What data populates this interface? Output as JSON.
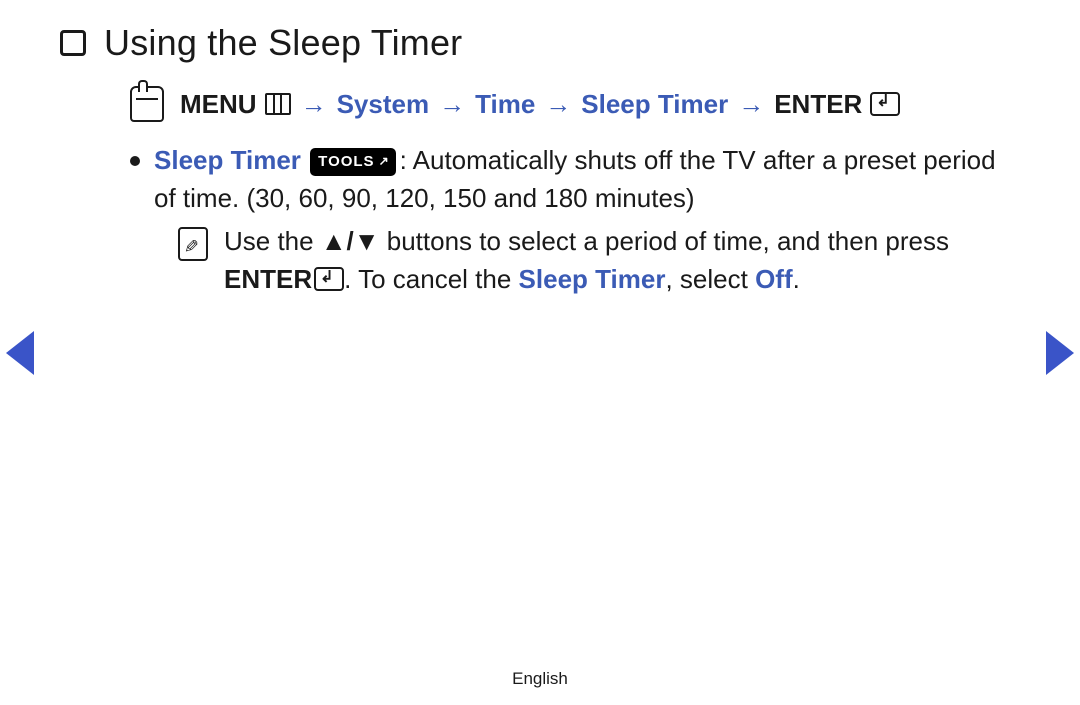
{
  "title": "Using the Sleep Timer",
  "breadcrumb": {
    "menu": "MENU",
    "system": "System",
    "time": "Time",
    "sleep_timer": "Sleep Timer",
    "enter": "ENTER",
    "sep": "→"
  },
  "content": {
    "sleep_timer_label": "Sleep Timer",
    "tools_badge": "TOOLS",
    "desc_1": ": Automatically shuts off the TV after a preset period of time. (30, 60, 90, 120, 150 and 180 minutes)",
    "note_prefix": "Use the ",
    "updown": "▲/▼",
    "note_mid": " buttons to select a period of time, and then press ",
    "enter_word": "ENTER",
    "note_after_enter": ". To cancel the ",
    "sleep_timer_inline": "Sleep Timer",
    "note_select": ", select ",
    "off_word": "Off",
    "period": "."
  },
  "footer": {
    "language": "English"
  }
}
